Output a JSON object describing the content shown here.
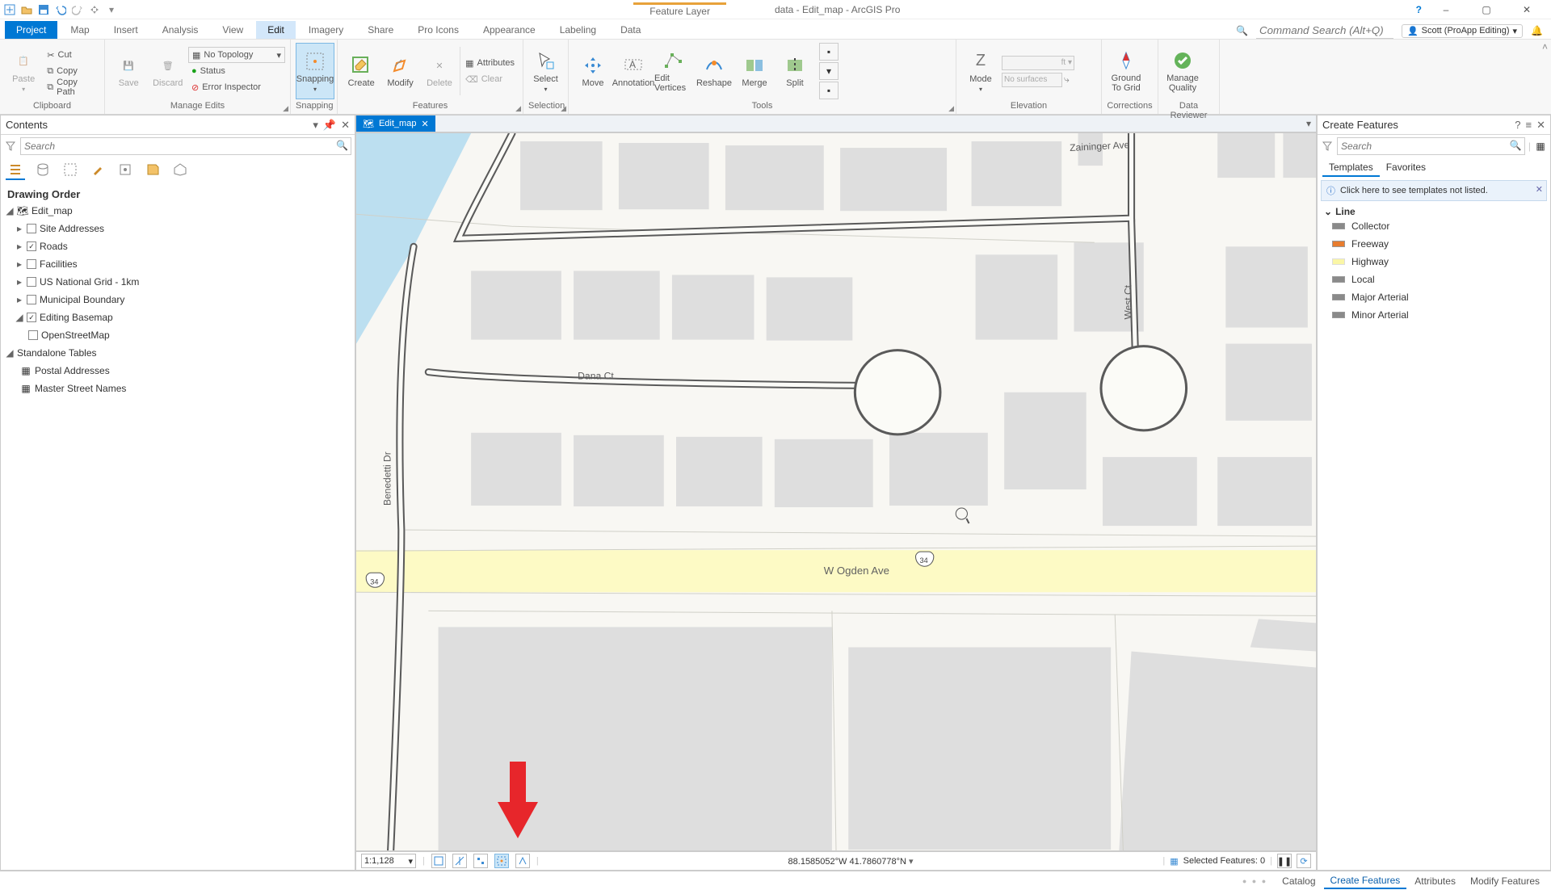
{
  "qa": {
    "context_tab": "Feature Layer",
    "title": "data - Edit_map - ArcGIS Pro"
  },
  "titlebar": {
    "help": "?",
    "user": "Scott (ProApp Editing)"
  },
  "ribbon": {
    "tabs": [
      "Project",
      "Map",
      "Insert",
      "Analysis",
      "View",
      "Edit",
      "Imagery",
      "Share",
      "Pro Icons",
      "Appearance",
      "Labeling",
      "Data"
    ],
    "active": "Edit",
    "search_placeholder": "Command Search (Alt+Q)"
  },
  "ribbon_groups": {
    "clipboard": {
      "label": "Clipboard",
      "paste": "Paste",
      "cut": "Cut",
      "copy": "Copy",
      "copypath": "Copy Path"
    },
    "manage_edits": {
      "label": "Manage Edits",
      "save": "Save",
      "discard": "Discard",
      "topology": "No Topology",
      "status": "Status",
      "error": "Error Inspector"
    },
    "snapping": {
      "label": "Snapping",
      "btn": "Snapping"
    },
    "features": {
      "label": "Features",
      "create": "Create",
      "modify": "Modify",
      "delete": "Delete",
      "attributes": "Attributes",
      "clear": "Clear"
    },
    "selection": {
      "label": "Selection",
      "select": "Select"
    },
    "tools": {
      "label": "Tools",
      "move": "Move",
      "annotation": "Annotation",
      "edit_vertices": "Edit Vertices",
      "reshape": "Reshape",
      "merge": "Merge",
      "split": "Split"
    },
    "elevation": {
      "label": "Elevation",
      "mode": "Mode",
      "surfaces": "No surfaces"
    },
    "corrections": {
      "label": "Corrections",
      "ground": "Ground To Grid"
    },
    "data_reviewer": {
      "label": "Data Reviewer",
      "quality": "Manage Quality"
    }
  },
  "contents": {
    "title": "Contents",
    "search_placeholder": "Search",
    "drawing_order": "Drawing Order",
    "map_frame": "Edit_map",
    "layers": {
      "site": "Site Addresses",
      "roads": "Roads",
      "facilities": "Facilities",
      "grid": "US National Grid - 1km",
      "muni": "Municipal Boundary",
      "basemap": "Editing Basemap",
      "osm": "OpenStreetMap"
    },
    "standalone": "Standalone Tables",
    "tables": {
      "postal": "Postal Addresses",
      "master": "Master Street Names"
    }
  },
  "view_tabs": {
    "map": "Edit_map"
  },
  "map": {
    "streets": {
      "zaininger": "Zaininger Ave",
      "dana": "Dana Ct",
      "ogden": "W Ogden Ave",
      "west": "West Ct",
      "benedetti": "Benedetti Dr"
    },
    "shield": "34"
  },
  "status": {
    "scale": "1:1,128",
    "coords": "88.1585052°W 41.7860778°N",
    "selected": "Selected Features: 0"
  },
  "cf": {
    "title": "Create Features",
    "search_placeholder": "Search",
    "tab_templates": "Templates",
    "tab_favorites": "Favorites",
    "info": "Click here to see templates not listed.",
    "group": "Line",
    "items": {
      "collector": "Collector",
      "freeway": "Freeway",
      "highway": "Highway",
      "local": "Local",
      "major": "Major Arterial",
      "minor": "Minor Arterial"
    }
  },
  "dock": {
    "catalog": "Catalog",
    "cf": "Create Features",
    "attr": "Attributes",
    "modify": "Modify Features"
  }
}
